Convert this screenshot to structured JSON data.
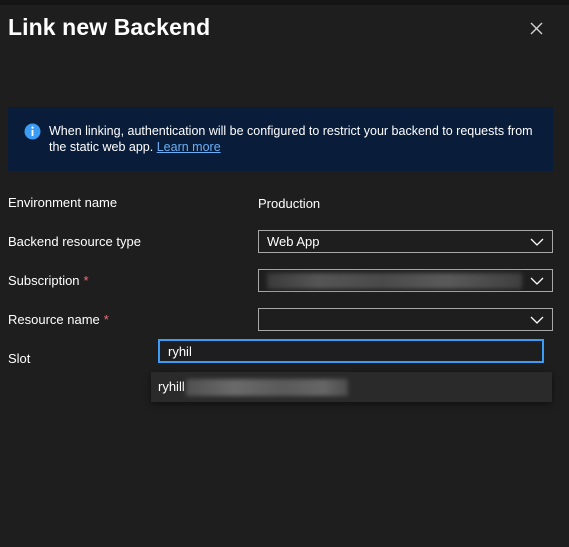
{
  "dialog": {
    "title": "Link new Backend",
    "close_icon": "close-icon"
  },
  "info_banner": {
    "icon": "info-icon",
    "text": "When linking, authentication will be configured to restrict your backend to requests from the static web app.",
    "link_text": "Learn more"
  },
  "form": {
    "environment": {
      "label": "Environment name",
      "value": "Production"
    },
    "backend_type": {
      "label": "Backend resource type",
      "value": "Web App"
    },
    "subscription": {
      "label": "Subscription",
      "required_mark": "*",
      "value": ""
    },
    "resource_name": {
      "label": "Resource name",
      "required_mark": "*",
      "value": ""
    },
    "slot": {
      "label": "Slot"
    }
  },
  "search": {
    "value": "ryhil",
    "results": [
      {
        "text": "ryhill"
      }
    ]
  },
  "colors": {
    "background": "#1e1e1e",
    "banner_bg": "#091d3a",
    "accent": "#3b9cf6",
    "link": "#69aff5",
    "required": "#f1707b"
  }
}
